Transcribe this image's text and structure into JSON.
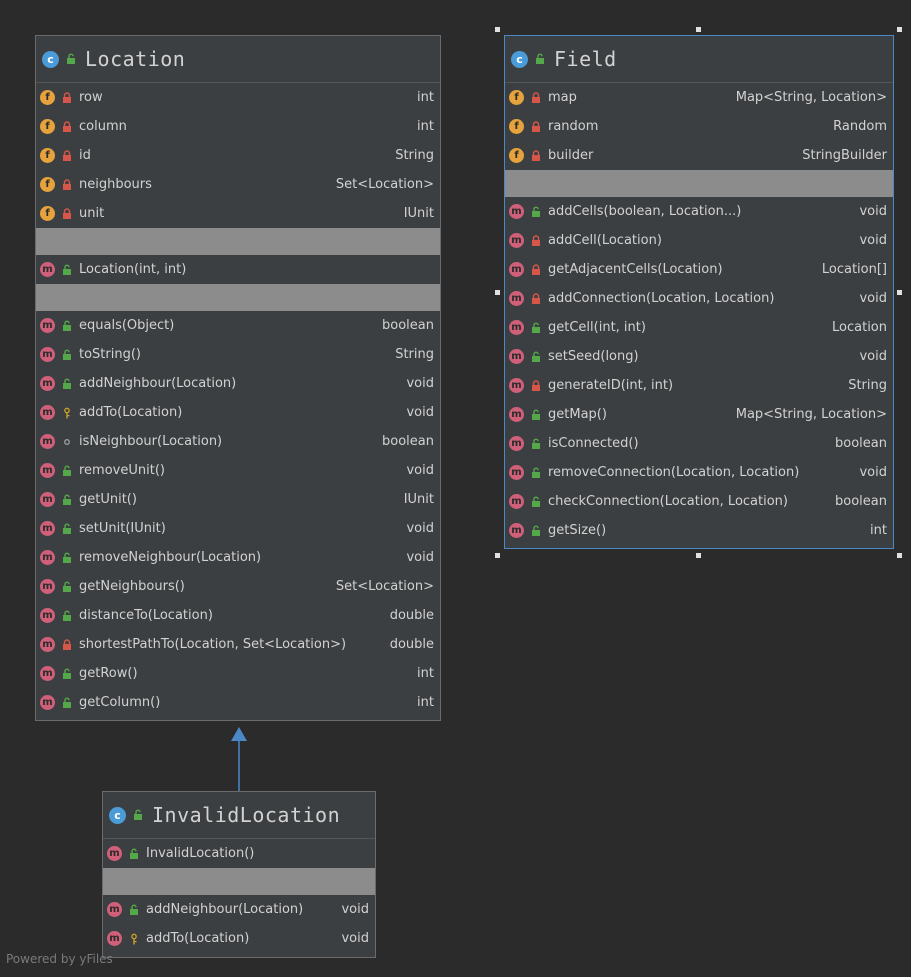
{
  "footer": "Powered by yFiles",
  "classes": {
    "location": {
      "name": "Location",
      "fields": [
        {
          "name": "row",
          "type": "int",
          "vis": "private"
        },
        {
          "name": "column",
          "type": "int",
          "vis": "private"
        },
        {
          "name": "id",
          "type": "String",
          "vis": "private"
        },
        {
          "name": "neighbours",
          "type": "Set<Location>",
          "vis": "private"
        },
        {
          "name": "unit",
          "type": "IUnit",
          "vis": "private"
        }
      ],
      "constructors": [
        {
          "name": "Location(int, int)",
          "type": "",
          "vis": "public"
        }
      ],
      "methods": [
        {
          "name": "equals(Object)",
          "type": "boolean",
          "vis": "public"
        },
        {
          "name": "toString()",
          "type": "String",
          "vis": "public"
        },
        {
          "name": "addNeighbour(Location)",
          "type": "void",
          "vis": "public"
        },
        {
          "name": "addTo(Location)",
          "type": "void",
          "vis": "protected"
        },
        {
          "name": "isNeighbour(Location)",
          "type": "boolean",
          "vis": "package"
        },
        {
          "name": "removeUnit()",
          "type": "void",
          "vis": "public"
        },
        {
          "name": "getUnit()",
          "type": "IUnit",
          "vis": "public"
        },
        {
          "name": "setUnit(IUnit)",
          "type": "void",
          "vis": "public"
        },
        {
          "name": "removeNeighbour(Location)",
          "type": "void",
          "vis": "public"
        },
        {
          "name": "getNeighbours()",
          "type": "Set<Location>",
          "vis": "public"
        },
        {
          "name": "distanceTo(Location)",
          "type": "double",
          "vis": "public"
        },
        {
          "name": "shortestPathTo(Location, Set<Location>)",
          "type": "double",
          "vis": "private"
        },
        {
          "name": "getRow()",
          "type": "int",
          "vis": "public"
        },
        {
          "name": "getColumn()",
          "type": "int",
          "vis": "public"
        }
      ]
    },
    "field": {
      "name": "Field",
      "fields": [
        {
          "name": "map",
          "type": "Map<String, Location>",
          "vis": "private"
        },
        {
          "name": "random",
          "type": "Random",
          "vis": "private"
        },
        {
          "name": "builder",
          "type": "StringBuilder",
          "vis": "private"
        }
      ],
      "methods": [
        {
          "name": "addCells(boolean, Location...)",
          "type": "void",
          "vis": "public"
        },
        {
          "name": "addCell(Location)",
          "type": "void",
          "vis": "private"
        },
        {
          "name": "getAdjacentCells(Location)",
          "type": "Location[]",
          "vis": "private"
        },
        {
          "name": "addConnection(Location, Location)",
          "type": "void",
          "vis": "private"
        },
        {
          "name": "getCell(int, int)",
          "type": "Location",
          "vis": "public"
        },
        {
          "name": "setSeed(long)",
          "type": "void",
          "vis": "public"
        },
        {
          "name": "generateID(int, int)",
          "type": "String",
          "vis": "private"
        },
        {
          "name": "getMap()",
          "type": "Map<String, Location>",
          "vis": "public"
        },
        {
          "name": "isConnected()",
          "type": "boolean",
          "vis": "public"
        },
        {
          "name": "removeConnection(Location, Location)",
          "type": "void",
          "vis": "public"
        },
        {
          "name": "checkConnection(Location, Location)",
          "type": "boolean",
          "vis": "public"
        },
        {
          "name": "getSize()",
          "type": "int",
          "vis": "public"
        }
      ]
    },
    "invalid": {
      "name": "InvalidLocation",
      "constructors": [
        {
          "name": "InvalidLocation()",
          "type": "",
          "vis": "public"
        }
      ],
      "methods": [
        {
          "name": "addNeighbour(Location)",
          "type": "void",
          "vis": "public"
        },
        {
          "name": "addTo(Location)",
          "type": "void",
          "vis": "protected"
        }
      ]
    }
  },
  "colors": {
    "background": "#2b2b2b",
    "box": "#3c3f41",
    "selected_border": "#4a88c7",
    "arrow": "#4a88c7",
    "field_badge": "#e6a23c",
    "method_badge": "#d0607a",
    "class_badge": "#4a9bd8",
    "public": "#55a84a",
    "private": "#d6564a"
  }
}
